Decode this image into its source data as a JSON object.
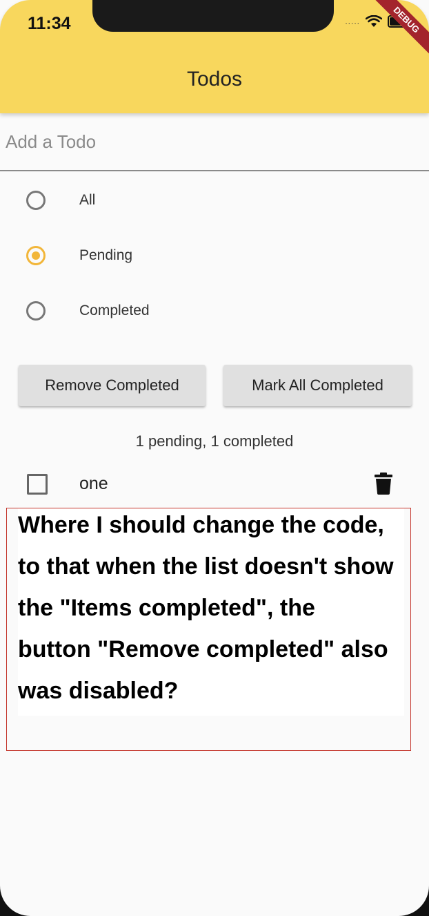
{
  "status_bar": {
    "time": "11:34",
    "debug_label": "DEBUG",
    "signal": "....."
  },
  "app_bar": {
    "title": "Todos",
    "background": "#f8d75d"
  },
  "input": {
    "placeholder": "Add a Todo",
    "value": ""
  },
  "filters": {
    "options": [
      {
        "label": "All",
        "selected": false
      },
      {
        "label": "Pending",
        "selected": true
      },
      {
        "label": "Completed",
        "selected": false
      }
    ],
    "accent": "#f2b63a"
  },
  "buttons": {
    "remove_completed": "Remove Completed",
    "mark_all_completed": "Mark All Completed"
  },
  "summary": "1 pending, 1 completed",
  "todos": [
    {
      "text": "one",
      "completed": false
    }
  ],
  "question": "Where I should change the code, to that when the list doesn't show the \"Items completed\", the button \"Remove completed\" also was disabled?"
}
